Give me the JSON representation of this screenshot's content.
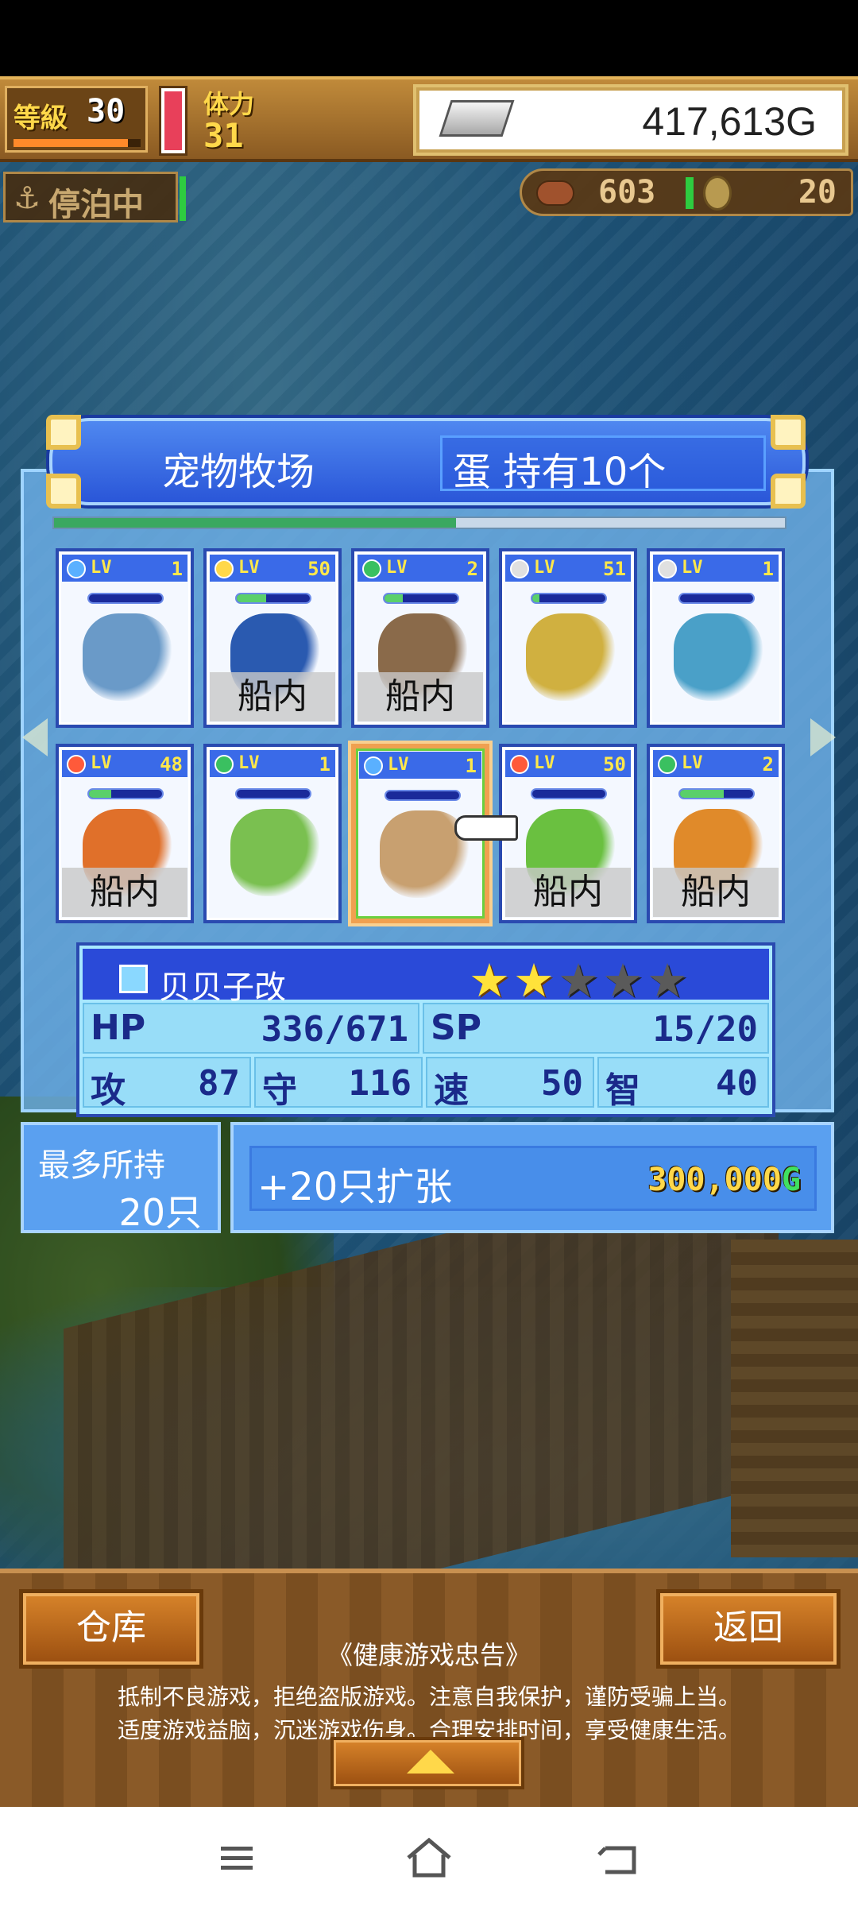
{
  "hud": {
    "level_label": "等級",
    "level_value": "30",
    "level_progress": 0.9,
    "stamina_label": "体力",
    "stamina_value": "31",
    "gold_value": "417,613G",
    "moored_label": "停泊中",
    "food_value": "603",
    "coin_value": "20"
  },
  "panel": {
    "title": "宠物牧场",
    "egg_text": "蛋 持有10个",
    "scroll_progress": 0.55
  },
  "pets": [
    {
      "element": "water",
      "element_color": "#5ab0ff",
      "lv_label": "LV",
      "lv": "1",
      "hp_fill": 0.0,
      "sprite": "turtle",
      "sprite_color": "#6a9ac8",
      "status": ""
    },
    {
      "element": "thunder",
      "element_color": "#ffd84a",
      "lv_label": "LV",
      "lv": "50",
      "hp_fill": 0.4,
      "sprite": "blue-dragon",
      "sprite_color": "#2a5ab0",
      "status": "船内"
    },
    {
      "element": "wind",
      "element_color": "#3ac060",
      "lv_label": "LV",
      "lv": "2",
      "hp_fill": 0.25,
      "sprite": "rock-crab",
      "sprite_color": "#8a6a4a",
      "status": "船内"
    },
    {
      "element": "light",
      "element_color": "#e0e0e0",
      "lv_label": "LV",
      "lv": "51",
      "hp_fill": 0.1,
      "sprite": "cube-robot",
      "sprite_color": "#d0b040",
      "status": ""
    },
    {
      "element": "light",
      "element_color": "#e0e0e0",
      "lv_label": "LV",
      "lv": "1",
      "hp_fill": 0.0,
      "sprite": "snake",
      "sprite_color": "#4aa0c8",
      "status": ""
    },
    {
      "element": "fire",
      "element_color": "#ff5a3a",
      "lv_label": "LV",
      "lv": "48",
      "hp_fill": 0.3,
      "sprite": "orange-dragon",
      "sprite_color": "#e0702a",
      "status": "船内"
    },
    {
      "element": "wind",
      "element_color": "#3ac060",
      "lv_label": "LV",
      "lv": "1",
      "hp_fill": 0.0,
      "sprite": "green-frog",
      "sprite_color": "#7ac050",
      "status": ""
    },
    {
      "element": "water",
      "element_color": "#5ab0ff",
      "lv_label": "LV",
      "lv": "1",
      "hp_fill": 0.0,
      "sprite": "hermit-crab",
      "sprite_color": "#c8a070",
      "status": "",
      "selected": true
    },
    {
      "element": "fire",
      "element_color": "#ff5a3a",
      "lv_label": "LV",
      "lv": "50",
      "hp_fill": 0.0,
      "sprite": "green-dino",
      "sprite_color": "#6ac040",
      "status": "船内"
    },
    {
      "element": "wind",
      "element_color": "#3ac060",
      "lv_label": "LV",
      "lv": "2",
      "hp_fill": 0.6,
      "sprite": "fire-imp",
      "sprite_color": "#e08a2a",
      "status": "船内"
    }
  ],
  "selected_pet": {
    "name": "贝贝子改",
    "rating": 2,
    "rating_max": 5,
    "hp_label": "HP",
    "hp_value": "336/671",
    "sp_label": "SP",
    "sp_value": "15/20",
    "atk_label": "攻",
    "atk_value": "87",
    "def_label": "守",
    "def_value": "116",
    "spd_label": "速",
    "spd_value": "50",
    "int_label": "智",
    "int_value": "40"
  },
  "capacity": {
    "label": "最多所持",
    "value": "20只"
  },
  "expand": {
    "label": "+20只扩张",
    "cost": "300,000",
    "currency": "G"
  },
  "bottom": {
    "warehouse_label": "仓库",
    "back_label": "返回",
    "notice_title": "《健康游戏忠告》",
    "notice_line1": "抵制不良游戏，拒绝盗版游戏。注意自我保护，谨防受骗上当。",
    "notice_line2": "适度游戏益脑，沉迷游戏伤身。合理安排时间，享受健康生活。"
  },
  "navbar": {
    "icons": [
      "menu-icon",
      "home-icon",
      "back-icon"
    ]
  }
}
